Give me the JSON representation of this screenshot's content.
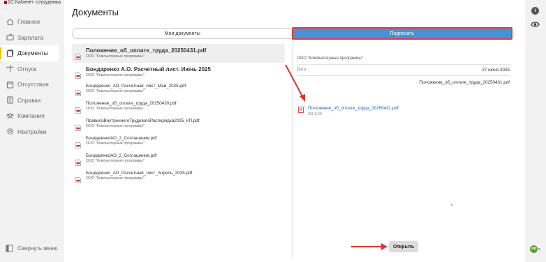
{
  "app": {
    "title": "1С:Кабинет сотрудника"
  },
  "sidebar": {
    "items": [
      {
        "label": "Главное",
        "icon": "home-icon"
      },
      {
        "label": "Зарплата",
        "icon": "wallet-icon"
      },
      {
        "label": "Документы",
        "icon": "documents-icon",
        "active": true
      },
      {
        "label": "Отпуск",
        "icon": "palm-icon"
      },
      {
        "label": "Отсутствия",
        "icon": "absence-icon"
      },
      {
        "label": "Справки",
        "icon": "certificate-icon"
      },
      {
        "label": "Компания",
        "icon": "company-icon"
      },
      {
        "label": "Настройки",
        "icon": "gear-icon"
      }
    ],
    "collapse_label": "Свернуть меню"
  },
  "page": {
    "title": "Документы"
  },
  "tabs": [
    {
      "label": "Мои документы",
      "active": false
    },
    {
      "label": "Подписать",
      "active": true
    }
  ],
  "documents": [
    {
      "name": "Положение_об_оплате_труда_20250431.pdf",
      "org": "ООО \"Компьютерные программы\"",
      "selected": true,
      "bold": true
    },
    {
      "name": "Бондаренко А.О. Расчетный лист. Июнь 2025",
      "org": "ООО \"Компьютерные программы\"",
      "bold": true
    },
    {
      "name": "Бондаренко_АО_Расчетный_лист_Май_2025.pdf",
      "org": "ООО \"Компьютерные программы\""
    },
    {
      "name": "Положение_об_оплате_труда_20250430.pdf",
      "org": "ООО \"Компьютерные программы\""
    },
    {
      "name": "ПравилаВнутреннегоТрудовогоРаспорядка2025_КП.pdf",
      "org": "ООО \"Компьютерные программы\""
    },
    {
      "name": "БондаренкоАО_2_Соглашение.pdf",
      "org": "ООО \"Компьютерные программы\""
    },
    {
      "name": "БондаренкоАО_2_Соглашение.pdf",
      "org": "ООО \"Компьютерные программы\""
    },
    {
      "name": "Бондаренко_АО_Расчетный_лист_Апрель_2025.pdf",
      "org": "ООО \"Компьютерные программы\""
    }
  ],
  "detail": {
    "org": "ООО \"Компьютерные программы\"",
    "date_label": "Дата",
    "date_value": "27 июня 2025",
    "doc_title": "Положение_об_оплате_труда_20250431.pdf",
    "attachment_name": "Положение_об_оплате_труда_20250431.pdf",
    "attachment_size": "231.5 Кб",
    "open_label": "Открыть"
  },
  "rail": {
    "info_glyph": "i",
    "avatar_initials": "АБ"
  },
  "colors": {
    "accent": "#4a90d9",
    "highlight_border": "#e53935",
    "annotation_arrow": "#d9362b",
    "active_marker": "#f2c200"
  }
}
